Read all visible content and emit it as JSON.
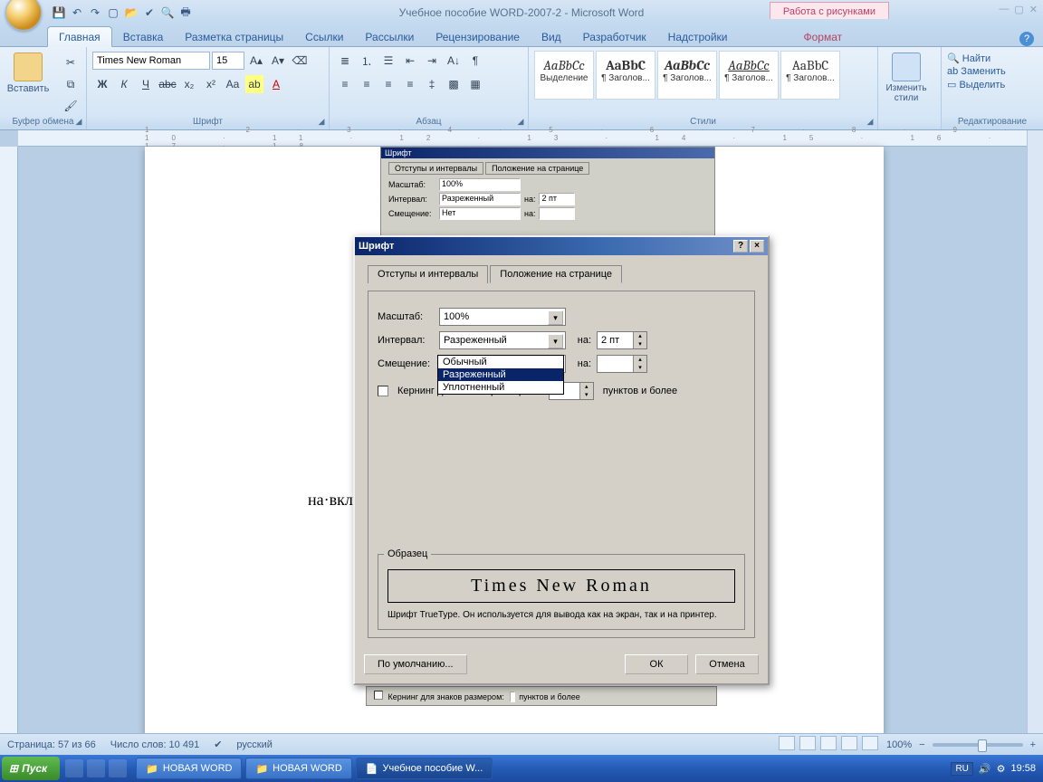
{
  "title": "Учебное пособие WORD-2007-2 - Microsoft Word",
  "context_tab": "Работа с рисунками",
  "tabs": [
    "Главная",
    "Вставка",
    "Разметка страницы",
    "Ссылки",
    "Рассылки",
    "Рецензирование",
    "Вид",
    "Разработчик",
    "Надстройки",
    "Формат"
  ],
  "active_tab": "Главная",
  "ribbon": {
    "clipboard": {
      "paste": "Вставить",
      "label": "Буфер обмена"
    },
    "font": {
      "name": "Times New Roman",
      "size": "15",
      "label": "Шрифт"
    },
    "paragraph": {
      "label": "Абзац"
    },
    "styles": {
      "label": "Стили",
      "items": [
        {
          "sample": "AaBbCc",
          "name": "Выделение"
        },
        {
          "sample": "AaBbC",
          "name": "¶ Заголов..."
        },
        {
          "sample": "AaBbCc",
          "name": "¶ Заголов..."
        },
        {
          "sample": "AaBbCc",
          "name": "¶ Заголов..."
        },
        {
          "sample": "AaBbC",
          "name": "¶ Заголов..."
        }
      ],
      "change": "Изменить стили"
    },
    "editing": {
      "find": "Найти",
      "replace": "Заменить",
      "select": "Выделить",
      "label": "Редактирование"
    }
  },
  "ruler": "1 · 2 · 3 · 4 · 5 · 6 · 7 · 8 · 9 · 10 · 11 · 12 · 13 · 14 · 15 · 16 · 17 · 18",
  "page_text": "на·вкл",
  "embedded": {
    "title": "Шрифт",
    "tab1": "Отступы и интервалы",
    "tab2": "Положение на странице",
    "scale_l": "Масштаб:",
    "scale_v": "100%",
    "spacing_l": "Интервал:",
    "spacing_v": "Разреженный",
    "on_l": "на:",
    "on_v": "2 пт",
    "pos_l": "Смещение:",
    "pos_v": "Нет",
    "on2_l": "на:",
    "kerning": "Кернинг для знаков размером:",
    "pts_more": "пунктов и более"
  },
  "dialog": {
    "title": "Шрифт",
    "tab1": "Отступы и интервалы",
    "tab2": "Положение на странице",
    "scale_l": "Масштаб:",
    "scale_v": "100%",
    "spacing_l": "Интервал:",
    "spacing_v": "Разреженный",
    "na": "на:",
    "na_v": "2 пт",
    "pos_l": "Смещение:",
    "pos_v": "",
    "na2": "на:",
    "kerning": "Кернинг для знаков размером:",
    "pts_more": "пунктов и более",
    "dropdown": [
      "Обычный",
      "Разреженный",
      "Уплотненный"
    ],
    "dropdown_selected": "Разреженный",
    "sample_legend": "Образец",
    "sample_text": "Times New Roman",
    "sample_desc": "Шрифт TrueType. Он используется для вывода как на экран, так и на принтер.",
    "btn_default": "По умолчанию...",
    "btn_ok": "ОК",
    "btn_cancel": "Отмена"
  },
  "status": {
    "page": "Страница: 57 из 66",
    "words": "Число слов: 10 491",
    "lang": "русский",
    "zoom": "100%"
  },
  "taskbar": {
    "start": "Пуск",
    "items": [
      "НОВАЯ WORD",
      "НОВАЯ WORD",
      "Учебное пособие W..."
    ],
    "lang": "RU",
    "time": "19:58"
  }
}
